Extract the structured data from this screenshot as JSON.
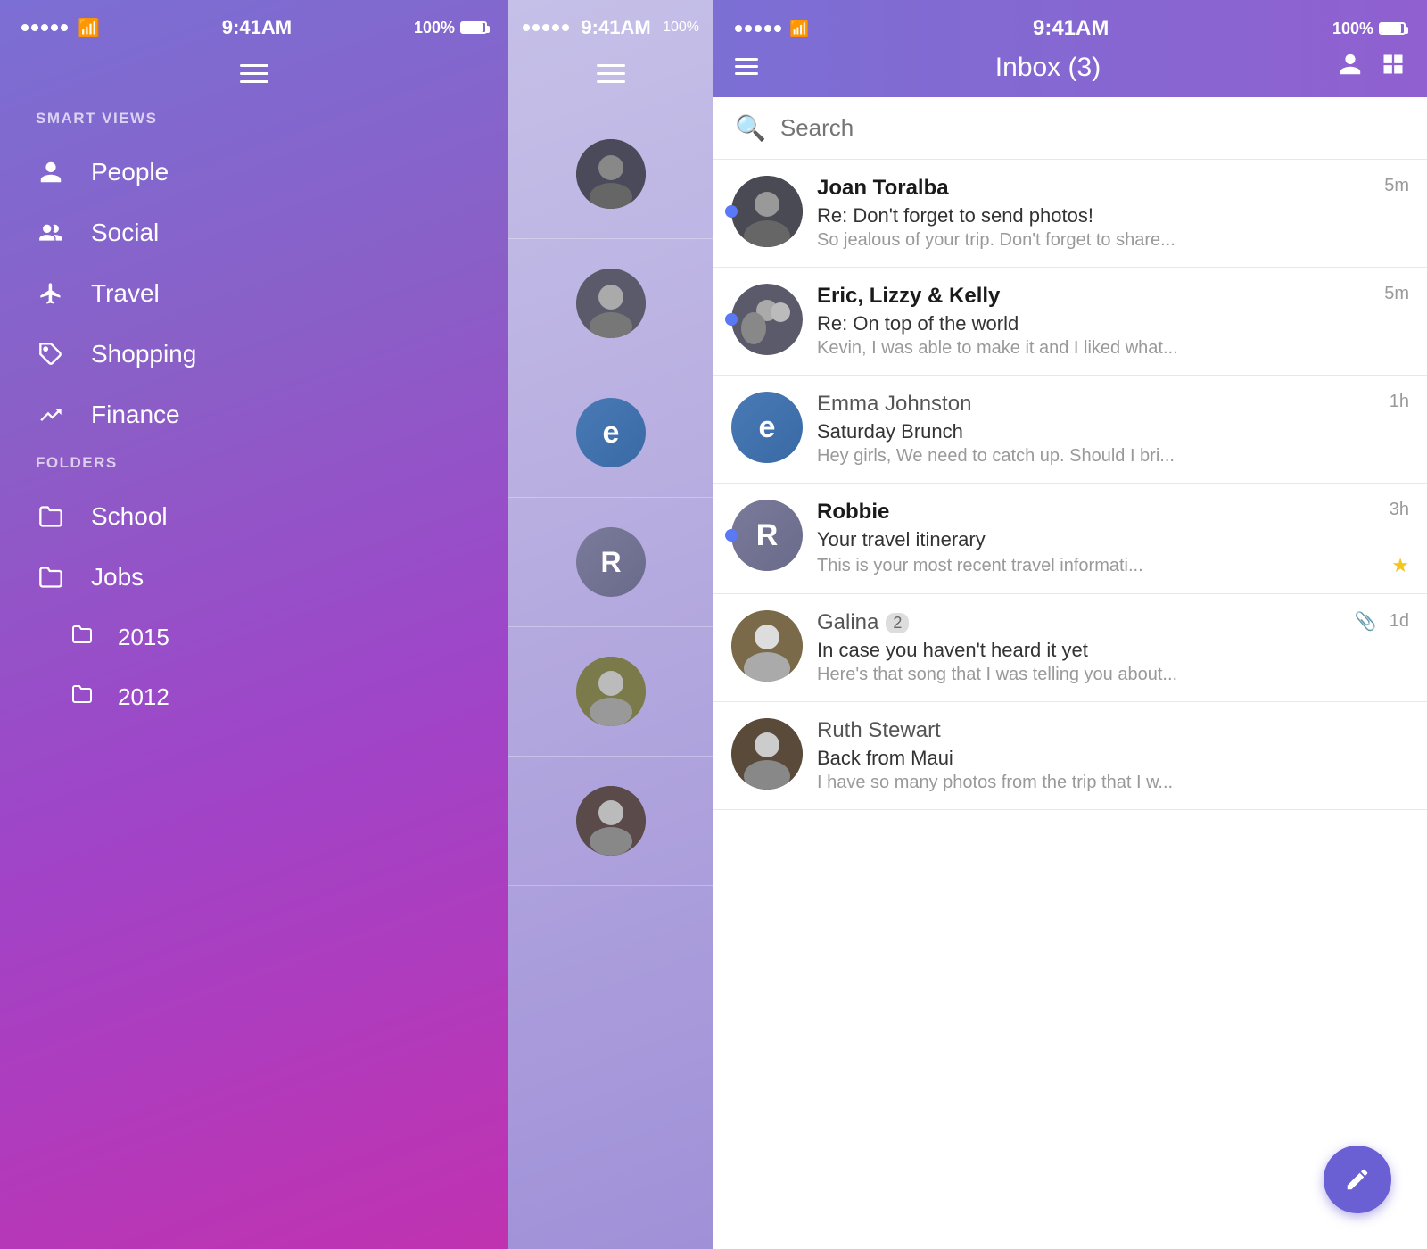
{
  "leftPhone": {
    "statusBar": {
      "time": "9:41AM",
      "battery": "100%"
    },
    "smartViewsLabel": "SMART VIEWS",
    "foldersLabel": "FOLDERS",
    "navItems": [
      {
        "id": "people",
        "label": "People",
        "icon": "person"
      },
      {
        "id": "social",
        "label": "Social",
        "icon": "people"
      },
      {
        "id": "travel",
        "label": "Travel",
        "icon": "plane"
      },
      {
        "id": "shopping",
        "label": "Shopping",
        "icon": "tag"
      },
      {
        "id": "finance",
        "label": "Finance",
        "icon": "trending"
      }
    ],
    "folderItems": [
      {
        "id": "school",
        "label": "School",
        "icon": "folder",
        "indent": false
      },
      {
        "id": "jobs",
        "label": "Jobs",
        "icon": "folder",
        "indent": false
      },
      {
        "id": "2015",
        "label": "2015",
        "icon": "folder",
        "indent": true
      },
      {
        "id": "2012",
        "label": "2012",
        "icon": "folder",
        "indent": true
      }
    ]
  },
  "rightPhone": {
    "statusBar": {
      "time": "9:41AM",
      "battery": "100%"
    },
    "header": {
      "title": "Inbox (3)"
    },
    "search": {
      "placeholder": "Search"
    },
    "emails": [
      {
        "id": "joan",
        "sender": "Joan Toralba",
        "subject": "Re: Don't forget to send photos!",
        "preview": "So jealous of your trip. Don't forget to share...",
        "time": "5m",
        "unread": true,
        "starred": false,
        "hasAttachment": false,
        "avatarText": "",
        "avatarType": "photo-joan",
        "badgeCount": null
      },
      {
        "id": "eric",
        "sender": "Eric, Lizzy & Kelly",
        "subject": "Re: On top of the world",
        "preview": "Kevin, I was able to make it and I liked what...",
        "time": "5m",
        "unread": true,
        "starred": false,
        "hasAttachment": false,
        "avatarText": "",
        "avatarType": "photo-eric",
        "badgeCount": null
      },
      {
        "id": "emma",
        "sender": "Emma Johnston",
        "subject": "Saturday Brunch",
        "preview": "Hey girls, We need to catch up. Should I bri...",
        "time": "1h",
        "unread": false,
        "starred": false,
        "hasAttachment": false,
        "avatarText": "e",
        "avatarType": "letter-e",
        "badgeCount": null
      },
      {
        "id": "robbie",
        "sender": "Robbie",
        "subject": "Your travel itinerary",
        "preview": "This is your most recent travel informati...",
        "time": "3h",
        "unread": true,
        "starred": true,
        "hasAttachment": false,
        "avatarText": "R",
        "avatarType": "letter-r",
        "badgeCount": null
      },
      {
        "id": "galina",
        "sender": "Galina",
        "subject": "In case you haven't heard it yet",
        "preview": "Here's that song that I was telling you about...",
        "time": "1d",
        "unread": false,
        "starred": false,
        "hasAttachment": true,
        "avatarText": "",
        "avatarType": "photo-galina",
        "badgeCount": "2"
      },
      {
        "id": "ruth",
        "sender": "Ruth Stewart",
        "subject": "Back from Maui",
        "preview": "I have so many photos from the trip that I w...",
        "time": "",
        "unread": false,
        "starred": false,
        "hasAttachment": false,
        "avatarText": "",
        "avatarType": "photo-ruth",
        "badgeCount": null
      }
    ],
    "composeFab": {
      "label": "✏️"
    }
  }
}
